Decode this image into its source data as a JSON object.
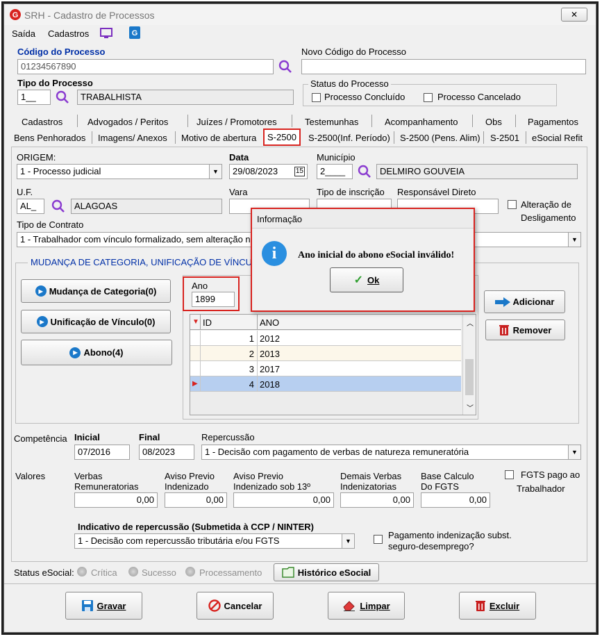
{
  "window": {
    "title": "SRH - Cadastro de Processos",
    "close_glyph": "✕"
  },
  "menu": {
    "saida": "Saída",
    "cadastros": "Cadastros"
  },
  "header": {
    "codigo_label": "Código do Processo",
    "codigo_value": "01234567890",
    "novo_codigo_label": "Novo Código do Processo",
    "novo_codigo_value": "",
    "tipo_label": "Tipo do Processo",
    "tipo_code": "1__",
    "tipo_desc": "TRABALHISTA",
    "status_group": "Status do Processo",
    "status_concluido": "Processo Concluído",
    "status_cancelado": "Processo Cancelado"
  },
  "tabs_row1": [
    "Cadastros",
    "Advogados / Peritos",
    "Juízes / Promotores",
    "Testemunhas",
    "Acompanhamento",
    "Obs",
    "Pagamentos"
  ],
  "tabs_row2": [
    "Bens Penhorados",
    "Imagens/ Anexos",
    "Motivo de abertura",
    "S-2500",
    "S-2500(Inf. Período)",
    "S-2500 (Pens. Alim)",
    "S-2501",
    "eSocial Refit"
  ],
  "form": {
    "origem_label": "ORIGEM:",
    "origem_value": "1 - Processo judicial",
    "data_label": "Data",
    "data_value": "29/08/2023",
    "calendar_glyph": "15",
    "municipio_label": "Município",
    "municipio_code": "2____",
    "municipio_name": "DELMIRO GOUVEIA",
    "uf_label": "U.F.",
    "uf_code": "AL_",
    "uf_name": "ALAGOAS",
    "vara_label": "Vara",
    "vara_value": "",
    "tipo_inscricao_label": "Tipo de inscrição",
    "responsavel_label": "Responsável Direto",
    "alteracao_label1": "Alteração de",
    "alteracao_label2": "Desligamento",
    "tipo_contrato_label": "Tipo de Contrato",
    "tipo_contrato_value": "1 - Trabalhador com vínculo formalizado, sem alteração n"
  },
  "mudanca": {
    "group_title": "MUDANÇA DE CATEGORIA, UNIFICAÇÃO DE VÍNCU",
    "btn_mudanca": "Mudança de Categoria(0)",
    "btn_unificacao": "Unificação de Vínculo(0)",
    "btn_abono": "Abono(4)",
    "ano_label": "Ano",
    "ano_value": "1899",
    "grid_headers": [
      "ID",
      "ANO"
    ],
    "grid_rows": [
      {
        "id": "1",
        "ano": "2012"
      },
      {
        "id": "2",
        "ano": "2013"
      },
      {
        "id": "3",
        "ano": "2017"
      },
      {
        "id": "4",
        "ano": "2018"
      }
    ],
    "btn_adicionar": "Adicionar",
    "btn_remover": "Remover"
  },
  "dialog": {
    "title": "Informação",
    "message": "Ano inicial do abono eSocial inválido!",
    "ok": "Ok",
    "info_glyph": "i"
  },
  "competencia": {
    "label": "Competência",
    "inicial_label": "Inicial",
    "inicial_value": "07/2016",
    "final_label": "Final",
    "final_value": "08/2023",
    "repercussao_label": "Repercussão",
    "repercussao_value": "1 - Decisão com pagamento de verbas de natureza remuneratória"
  },
  "valores": {
    "label": "Valores",
    "verbas_l1": "Verbas",
    "verbas_l2": "Remuneratorias",
    "verbas_value": "0,00",
    "aviso_l1": "Aviso Previo",
    "aviso_l2": "Indenizado",
    "aviso_value": "0,00",
    "aviso13_l1": "Aviso Previo",
    "aviso13_l2": "Indenizado sob 13º",
    "aviso13_value": "0,00",
    "demais_l1": "Demais Verbas",
    "demais_l2": "Indenizatorias",
    "demais_value": "0,00",
    "base_l1": "Base Calculo",
    "base_l2": "Do FGTS",
    "base_value": "0,00",
    "fgts_l1": "FGTS pago ao",
    "fgts_l2": "Trabalhador"
  },
  "indicativo": {
    "label": "Indicativo de repercussão (Submetida à CCP / NINTER)",
    "value": "1 - Decisão com repercussão tributária e/ou FGTS",
    "pagamento_l1": "Pagamento indenização subst.",
    "pagamento_l2": "seguro-desemprego?"
  },
  "status_esocial": {
    "label": "Status eSocial:",
    "critica": "Crítica",
    "sucesso": "Sucesso",
    "processamento": "Processamento",
    "historico": "Histórico eSocial"
  },
  "footer": {
    "gravar": "Gravar",
    "cancelar": "Cancelar",
    "limpar": "Limpar",
    "excluir": "Excluir"
  },
  "colors": {
    "accent_blue": "#1a78c9",
    "highlight_red": "#d8231f",
    "selected_row": "#b7cff0"
  }
}
